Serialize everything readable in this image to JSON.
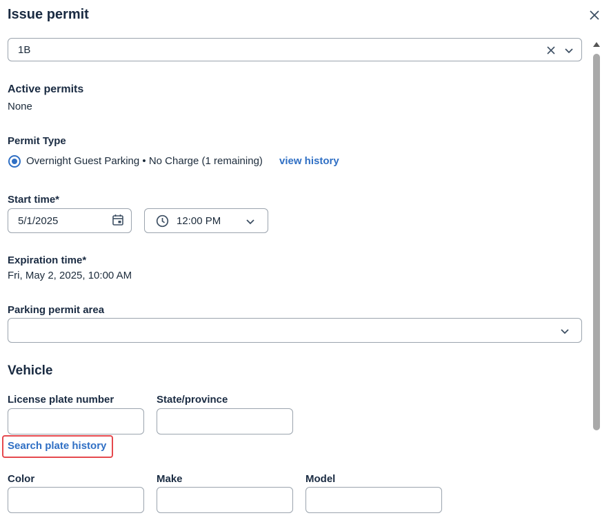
{
  "dialog": {
    "title": "Issue permit"
  },
  "unit_select": {
    "value": "1B"
  },
  "active_permits": {
    "label": "Active permits",
    "value": "None"
  },
  "permit_type": {
    "label": "Permit Type",
    "option": "Overnight Guest Parking • No Charge (1 remaining)",
    "view_history": "view history"
  },
  "start_time": {
    "label": "Start time*",
    "date": "5/1/2025",
    "time": "12:00 PM"
  },
  "expiration": {
    "label": "Expiration time*",
    "value": "Fri, May 2, 2025, 10:00 AM"
  },
  "parking_area": {
    "label": "Parking permit area",
    "value": ""
  },
  "vehicle": {
    "heading": "Vehicle",
    "plate_label": "License plate number",
    "state_label": "State/province",
    "search_history": "Search plate history",
    "color_label": "Color",
    "make_label": "Make",
    "model_label": "Model"
  }
}
